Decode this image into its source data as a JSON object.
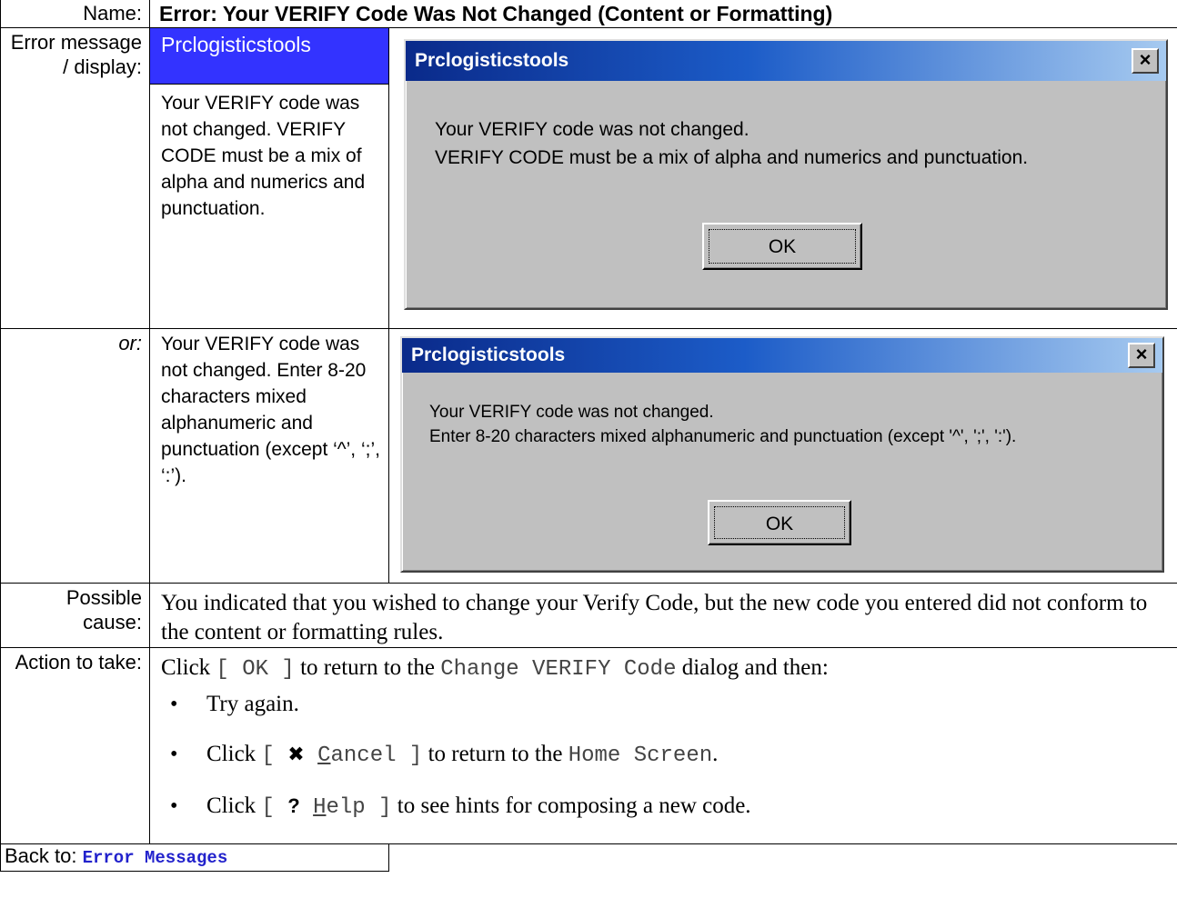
{
  "header": {
    "name_label": "Name:",
    "title": "Error: Your VERIFY Code Was Not Changed (Content or Formatting)"
  },
  "error1": {
    "label": "Error message / display:",
    "app_name": "Prclogisticstools",
    "message": "Your VERIFY code was not changed. VERIFY CODE must be a mix of alpha and numerics and punctuation.",
    "dialog": {
      "title": "Prclogisticstools",
      "close": "×",
      "line1": "Your VERIFY code was not changed.",
      "line2": "VERIFY CODE must be a mix of alpha and numerics and punctuation.",
      "ok": "OK"
    }
  },
  "error2": {
    "label": "or:",
    "message": "Your VERIFY code was not changed. Enter 8-20 characters mixed alphanumeric and punctuation (except ‘^’, ‘;’, ‘:’).",
    "dialog": {
      "title": "Prclogisticstools",
      "close": "×",
      "line1": "Your VERIFY code was not changed.",
      "line2": "Enter 8-20 characters mixed alphanumeric and punctuation (except '^', ';', ':').",
      "ok": "OK"
    }
  },
  "cause": {
    "label": "Possible cause:",
    "text": "You indicated that you wished to change your Verify Code, but the new code you entered did not conform to the content or formatting rules."
  },
  "action": {
    "label": "Action to take:",
    "intro_pre": "Click ",
    "intro_btn": "[ OK ]",
    "intro_mid": " to return to the ",
    "intro_dialog": "Change VERIFY Code",
    "intro_post": " dialog and then:",
    "step1": "Try again.",
    "step2_pre": "Click ",
    "step2_open": "[ ",
    "step2_icon": "✖",
    "step2_u": "C",
    "step2_rest": "ancel ]",
    "step2_mid": " to return to the ",
    "step2_screen": "Home Screen",
    "step2_post": ".",
    "step3_pre": "Click ",
    "step3_open": "[ ",
    "step3_icon": "?",
    "step3_u": "H",
    "step3_rest": "elp ]",
    "step3_post": " to see hints for composing a new code."
  },
  "footer": {
    "back_label": "Back to: ",
    "back_link": "Error Messages"
  }
}
